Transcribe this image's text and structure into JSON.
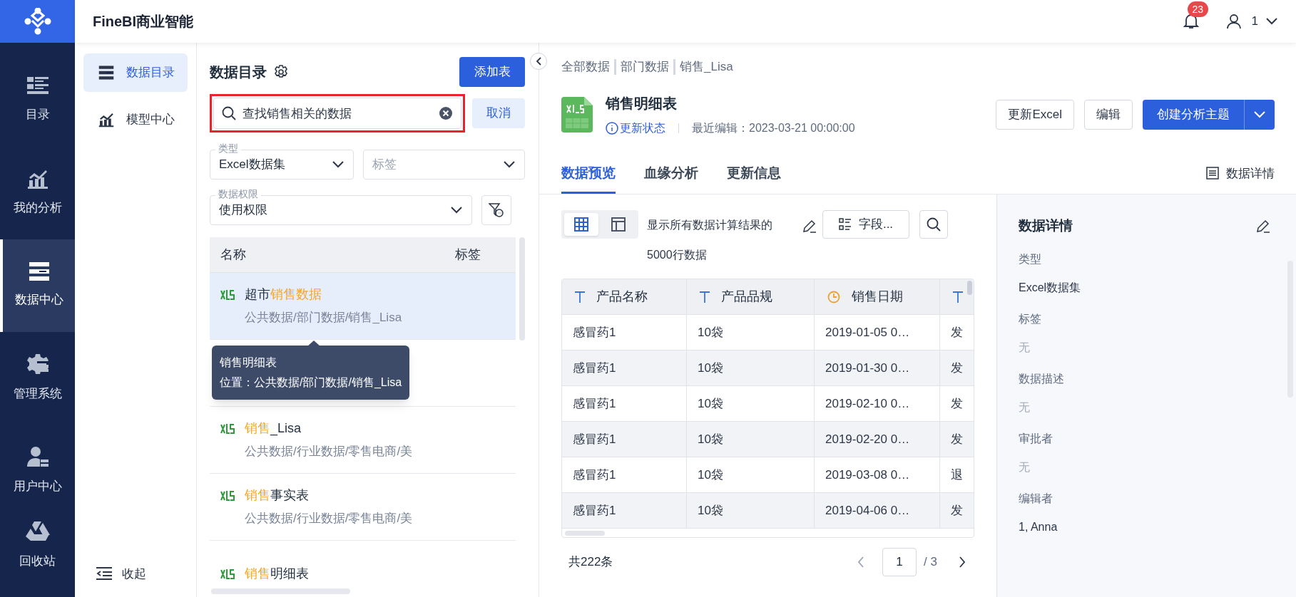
{
  "app": {
    "title": "FineBI商业智能"
  },
  "header": {
    "notification_count": "23",
    "user_name": "1"
  },
  "nav": [
    {
      "label": "目录",
      "selected": false
    },
    {
      "label": "我的分析",
      "selected": false
    },
    {
      "label": "数据中心",
      "selected": true
    },
    {
      "label": "管理系统",
      "selected": false
    },
    {
      "label": "用户中心",
      "selected": false
    },
    {
      "label": "回收站",
      "selected": false
    }
  ],
  "subnav": {
    "items": [
      {
        "label": "数据目录",
        "selected": true
      },
      {
        "label": "模型中心",
        "selected": false
      }
    ],
    "collapse_label": "收起"
  },
  "catalog": {
    "title": "数据目录",
    "add_button": "添加表",
    "search": {
      "value": "查找销售相关的数据",
      "annotated": true
    },
    "cancel_button": "取消",
    "type_filter": {
      "label": "类型",
      "value": "Excel数据集"
    },
    "tag_filter": {
      "placeholder": "标签"
    },
    "permission_filter": {
      "label": "数据权限",
      "value": "使用权限"
    },
    "list_columns": [
      "名称",
      "标签"
    ],
    "items": [
      {
        "name_parts": [
          {
            "text": "超市",
            "highlight": false
          },
          {
            "text": "销售数据",
            "highlight": true
          }
        ],
        "path": "公共数据/部门数据/销售_Lisa",
        "selected": true
      },
      {
        "name_parts": [
          {
            "text": "销售",
            "highlight": true
          },
          {
            "text": "_Lisa",
            "highlight": false
          }
        ],
        "path": "公共数据/行业数据/零售电商/美",
        "selected": false
      },
      {
        "name_parts": [
          {
            "text": "销售",
            "highlight": true
          },
          {
            "text": "事实表",
            "highlight": false
          }
        ],
        "path": "公共数据/行业数据/零售电商/美",
        "selected": false
      },
      {
        "name_parts": [
          {
            "text": "销售",
            "highlight": true
          },
          {
            "text": "明细表",
            "highlight": false
          }
        ],
        "selected": false
      }
    ],
    "tooltip": {
      "title": "销售明细表",
      "location": "位置：公共数据/部门数据/销售_Lisa"
    }
  },
  "main": {
    "breadcrumb": [
      "全部数据",
      "部门数据",
      "销售_Lisa"
    ],
    "title": "销售明细表",
    "status_link": "更新状态",
    "last_edit": "最近编辑：2023-03-21 00:00:00",
    "buttons": [
      {
        "label": "更新Excel",
        "kind": "outline"
      },
      {
        "label": "编辑",
        "kind": "outline"
      },
      {
        "label": "创建分析主题",
        "kind": "split"
      }
    ],
    "tabs": [
      {
        "label": "数据预览",
        "selected": true
      },
      {
        "label": "血缘分析",
        "selected": false
      },
      {
        "label": "更新信息",
        "selected": false
      }
    ],
    "details_link": "数据详情",
    "view_toggle": [
      {
        "selected": true
      },
      {
        "selected": false
      }
    ],
    "summary": "显示所有数据计算结果的5000行数据",
    "fields_button": "字段...",
    "table": {
      "columns": [
        {
          "label": "产品名称",
          "kind": "text"
        },
        {
          "label": "产品品规",
          "kind": "text"
        },
        {
          "label": "销售日期",
          "kind": "date"
        },
        {
          "kind": "text"
        }
      ],
      "rows": [
        [
          "感冒药1",
          "10袋",
          "2019-01-05 0…",
          "发"
        ],
        [
          "感冒药1",
          "10袋",
          "2019-01-30 0…",
          "发"
        ],
        [
          "感冒药1",
          "10袋",
          "2019-02-10 0…",
          "发"
        ],
        [
          "感冒药1",
          "10袋",
          "2019-02-20 0…",
          "发"
        ],
        [
          "感冒药1",
          "10袋",
          "2019-03-08 0…",
          "退"
        ],
        [
          "感冒药1",
          "10袋",
          "2019-04-06 0…",
          "发"
        ]
      ]
    },
    "pagination": {
      "total": "共222条",
      "page": "1",
      "pages": "/ 3"
    }
  },
  "details": {
    "title": "数据详情",
    "fields": [
      {
        "label": "类型",
        "value": "Excel数据集",
        "empty": false
      },
      {
        "label": "标签",
        "value": "无",
        "empty": true
      },
      {
        "label": "数据描述",
        "value": "无",
        "empty": true
      },
      {
        "label": "审批者",
        "value": "无",
        "empty": true
      },
      {
        "label": "编辑者",
        "value": "1, Anna",
        "empty": false
      }
    ]
  }
}
